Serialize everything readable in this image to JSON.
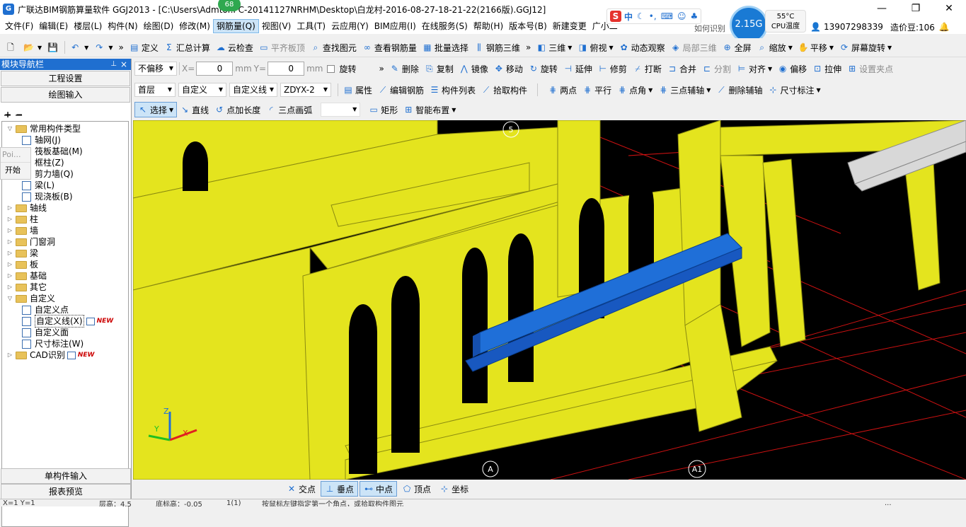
{
  "window": {
    "title": "广联达BIM钢筋算量软件 GGJ2013 - [C:\\Users\\Adm",
    "title_rest": "tor.PC-20141127NRHM\\Desktop\\白龙村-2016-08-27-18-21-22(2166版).GGJ12]",
    "badge": "68",
    "minimize": "—",
    "maximize": "❐",
    "close": "✕"
  },
  "menu": [
    "文件(F)",
    "编辑(E)",
    "楼层(L)",
    "构件(N)",
    "绘图(D)",
    "修改(M)",
    "钢筋量(Q)",
    "视图(V)",
    "工具(T)",
    "云应用(Y)",
    "BIM应用(I)",
    "在线服务(S)",
    "帮助(H)",
    "版本号(B)",
    "新建变更",
    "广小二"
  ],
  "menu_active_index": 6,
  "system": {
    "ime_logo": "S",
    "ime_mode": "中",
    "mem": "2.15G",
    "temp": "55°C",
    "cpu_label": "CPU温度",
    "extra": "如何识别",
    "phone": "13907298339",
    "beans": "造价豆:106"
  },
  "toolbar1": {
    "items": [
      "定义",
      "汇总计算",
      "云检查",
      "平齐板顶",
      "查找图元",
      "查看钢筋量",
      "批量选择",
      "钢筋三维"
    ],
    "disabled": [
      "平齐板顶"
    ],
    "right_items": [
      "三维",
      "俯视",
      "动态观察",
      "局部三维",
      "全屏",
      "缩放",
      "平移",
      "屏幕旋转"
    ]
  },
  "toolbar2": {
    "offset_mode": "不偏移",
    "x_label": "X=",
    "x_value": "0",
    "y_label": "Y=",
    "y_value": "0",
    "unit": "mm",
    "rotate": "旋转",
    "edit_items": [
      "删除",
      "复制",
      "镜像",
      "移动",
      "旋转",
      "延伸",
      "修剪",
      "打断",
      "合并",
      "分割",
      "对齐",
      "偏移",
      "拉伸",
      "设置夹点"
    ]
  },
  "toolbar3": {
    "floor": "首层",
    "category": "自定义",
    "type": "自定义线",
    "name": "ZDYX-2",
    "items": [
      "属性",
      "编辑钢筋",
      "构件列表",
      "拾取构件"
    ],
    "aux_items": [
      "两点",
      "平行",
      "点角",
      "三点辅轴",
      "删除辅轴",
      "尺寸标注"
    ]
  },
  "toolbar4": {
    "items": [
      "选择",
      "直线",
      "点加长度",
      "三点画弧"
    ],
    "items2": [
      "矩形",
      "智能布置"
    ]
  },
  "panel": {
    "title": "模块导航栏",
    "pin": "📌",
    "close": "×",
    "btn_project": "工程设置",
    "btn_draw": "绘图输入",
    "btn_single": "单构件输入",
    "btn_report": "报表预览"
  },
  "tree": [
    {
      "label": "常用构件类型",
      "level": 0,
      "type": "folder",
      "expanded": true
    },
    {
      "label": "轴网(J)",
      "level": 1,
      "type": "item",
      "icon": "axis-grid-icon"
    },
    {
      "label": "筏板基础(M)",
      "level": 1,
      "type": "item",
      "icon": "raft-foundation-icon"
    },
    {
      "label": "框柱(Z)",
      "level": 1,
      "type": "item",
      "icon": "frame-column-icon"
    },
    {
      "label": "剪力墙(Q)",
      "level": 1,
      "type": "item",
      "icon": "shear-wall-icon"
    },
    {
      "label": "梁(L)",
      "level": 1,
      "type": "item",
      "icon": "beam-icon"
    },
    {
      "label": "现浇板(B)",
      "level": 1,
      "type": "item",
      "icon": "slab-icon"
    },
    {
      "label": "轴线",
      "level": 0,
      "type": "folder"
    },
    {
      "label": "柱",
      "level": 0,
      "type": "folder"
    },
    {
      "label": "墙",
      "level": 0,
      "type": "folder"
    },
    {
      "label": "门窗洞",
      "level": 0,
      "type": "folder"
    },
    {
      "label": "梁",
      "level": 0,
      "type": "folder"
    },
    {
      "label": "板",
      "level": 0,
      "type": "folder"
    },
    {
      "label": "基础",
      "level": 0,
      "type": "folder"
    },
    {
      "label": "其它",
      "level": 0,
      "type": "folder"
    },
    {
      "label": "自定义",
      "level": 0,
      "type": "folder",
      "expanded": true
    },
    {
      "label": "自定义点",
      "level": 1,
      "type": "item",
      "icon": "custom-point-icon"
    },
    {
      "label": "自定义线(X)",
      "level": 1,
      "type": "item",
      "icon": "custom-line-icon",
      "selected": true,
      "badge": "NEW"
    },
    {
      "label": "自定义面",
      "level": 1,
      "type": "item",
      "icon": "custom-face-icon"
    },
    {
      "label": "尺寸标注(W)",
      "level": 1,
      "type": "item",
      "icon": "dimension-icon"
    },
    {
      "label": "CAD识别",
      "level": 0,
      "type": "folder",
      "badge": "NEW"
    }
  ],
  "popup": {
    "line1": "Poi...",
    "line2": "开始"
  },
  "viewport": {
    "axis_labels": [
      "5",
      "A",
      "A1"
    ],
    "axes": {
      "z": "Z",
      "y": "Y",
      "x": "X"
    }
  },
  "snap": [
    "交点",
    "垂点",
    "中点",
    "顶点",
    "坐标"
  ],
  "snap_on": [
    1,
    2
  ],
  "status": {
    "coords": "X=1 Y=1",
    "floor_height": "层高：4.5",
    "bottom_elev": "底标高：-0.05",
    "ratio": "1(1)",
    "hint": "按鼠标左键指定第一个角点，或拾取构件图元",
    "fps": "..."
  },
  "colors": {
    "title_blue": "#1f6fd0",
    "wall_yellow": "#e4e41e",
    "beam_blue": "#1f6fd8",
    "grid_red": "#cc1111"
  }
}
